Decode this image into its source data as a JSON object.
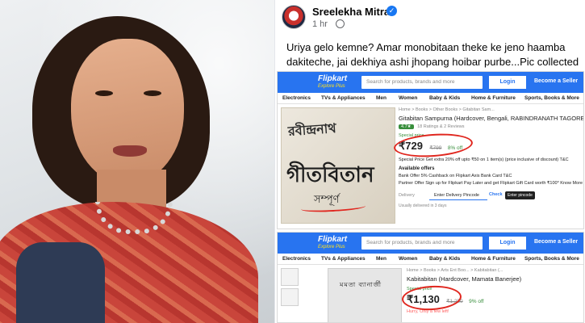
{
  "post": {
    "author": "Sreelekha Mitra",
    "verified_icon": "verified-badge-icon",
    "time": "1 hr",
    "caption": "Uriya gelo kemne? Amar monobitaan theke ke jeno haamba dakiteche, jai dekhiya ashi jhopang hoibar purbe...Pic collected"
  },
  "flipkart": {
    "logo": "Flipkart",
    "tagline": "Explore Plus",
    "search_placeholder": "Search for products, brands and more",
    "login": "Login",
    "seller": "Become a Seller",
    "categories": [
      "Electronics",
      "TVs & Appliances",
      "Men",
      "Women",
      "Baby & Kids",
      "Home & Furniture",
      "Sports, Books & More"
    ]
  },
  "product1": {
    "breadcrumb": "Home > Books > Other Books > Gitabitan Sam...",
    "title": "Gitabitan Sampurna  (Hardcover, Bengali, RABINDRANATH TAGORE)",
    "rating": "4.7★",
    "ratings_count": "18 Ratings & 2 Reviews",
    "special_price_label": "Special price",
    "price": "₹729",
    "mrp": "₹799",
    "discount": "8% off",
    "offers": [
      "Special Price  Get extra 20% off upto ₹50 on 1 item(s) (price inclusive of discount) T&C",
      "Bank Offer  5% Cashback on Flipkart Axis Bank Card  T&C",
      "Partner Offer  Sign up for Flipkart Pay Later and get Flipkart Gift Card worth ₹100* Know More"
    ],
    "available_offers": "Available offers",
    "delivery_label": "Delivery",
    "pincode_placeholder": "Enter Delivery Pincode",
    "check": "Check",
    "tooltip": "Enter pincode",
    "delivery_note": "Usually delivered in 3 days",
    "cover_line1": "রবীন্দ্রনাথ",
    "cover_line2": "গীতবিতান",
    "cover_line3": "সম্পূর্ণ"
  },
  "product2": {
    "breadcrumb": "Home > Books > Arts Ent Boo... > Kabitabitan (...",
    "title": "Kabitabitan  (Hardcover, Mamata Banerjee)",
    "special_price_label": "Special price",
    "price": "₹1,130",
    "mrp": "₹1,250",
    "discount": "9% off",
    "hurry": "Hurry, Only a few left!",
    "cover_title": "মমতা ব্যানার্জী"
  }
}
